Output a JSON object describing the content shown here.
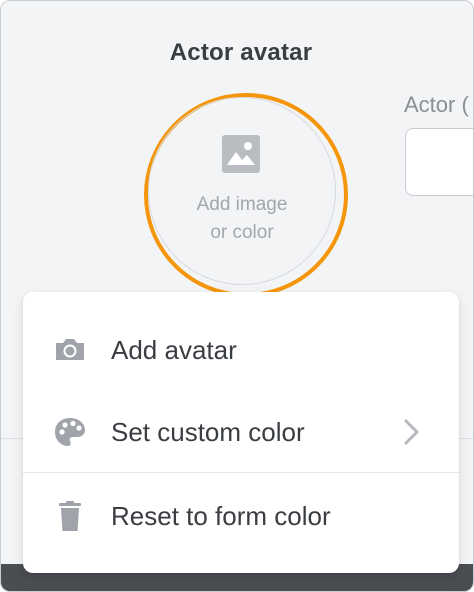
{
  "section": {
    "title": "Actor avatar"
  },
  "actor_field": {
    "label": "Actor ("
  },
  "avatar": {
    "line1": "Add image",
    "line2": "or color",
    "icon": "image-icon",
    "ring_color": "#f5960a"
  },
  "menu": {
    "items": [
      {
        "label": "Add avatar",
        "icon": "camera-icon"
      },
      {
        "label": "Set custom color",
        "icon": "palette-icon",
        "submenu": true
      },
      {
        "label": "Reset to form color",
        "icon": "trash-icon"
      }
    ]
  },
  "colors": {
    "accent": "#f5960a",
    "text": "#3a3d42",
    "muted": "#a3a7ad",
    "icon": "#a0a4aa"
  }
}
